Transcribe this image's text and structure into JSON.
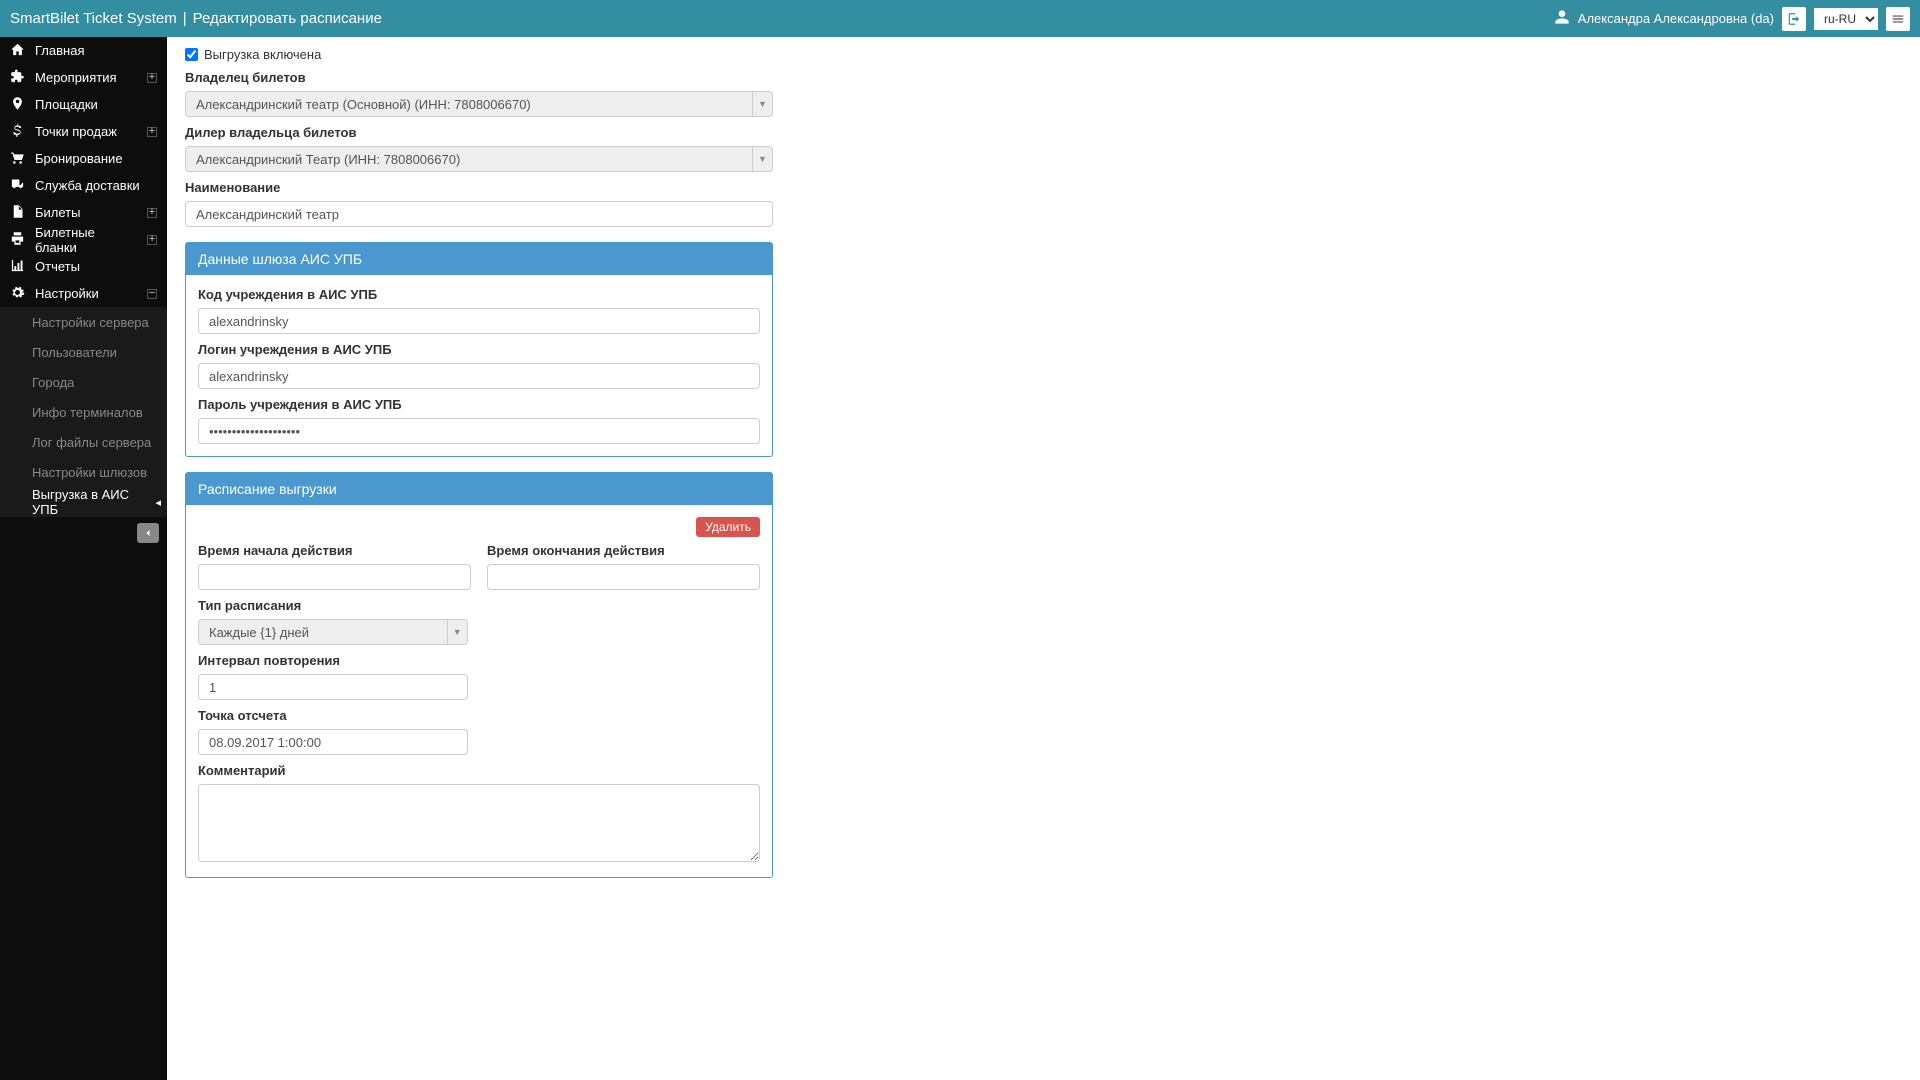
{
  "header": {
    "app_title": "SmartBilet Ticket System",
    "divider": "|",
    "page_title": "Редактировать расписание",
    "user_name": "Александра Александровна (da)",
    "locale": "ru-RU"
  },
  "sidebar": {
    "items": [
      {
        "label": "Главная",
        "icon": "home",
        "expandable": false
      },
      {
        "label": "Мероприятия",
        "icon": "puzzle",
        "expandable": true
      },
      {
        "label": "Площадки",
        "icon": "pin",
        "expandable": false
      },
      {
        "label": "Точки продаж",
        "icon": "dollar",
        "expandable": true
      },
      {
        "label": "Бронирование",
        "icon": "cart",
        "expandable": false
      },
      {
        "label": "Служба доставки",
        "icon": "truck",
        "expandable": false
      },
      {
        "label": "Билеты",
        "icon": "file",
        "expandable": true
      },
      {
        "label": "Билетные бланки",
        "icon": "print",
        "expandable": true
      },
      {
        "label": "Отчеты",
        "icon": "chart",
        "expandable": false
      },
      {
        "label": "Настройки",
        "icon": "gears",
        "expandable": true,
        "expanded": true
      }
    ],
    "subitems": [
      {
        "label": "Настройки сервера"
      },
      {
        "label": "Пользователи"
      },
      {
        "label": "Города"
      },
      {
        "label": "Инфо терминалов"
      },
      {
        "label": "Лог файлы сервера"
      },
      {
        "label": "Настройки шлюзов"
      },
      {
        "label": "Выгрузка в АИС УПБ",
        "active": true
      }
    ]
  },
  "form": {
    "export_enabled_label": "Выгрузка включена",
    "owner_label": "Владелец билетов",
    "owner_value": "Александринский театр (Основной) (ИНН: 7808006670)",
    "dealer_label": "Дилер владельца билетов",
    "dealer_value": "Александринский Театр (ИНН: 7808006670)",
    "name_label": "Наименование",
    "name_value": "Александринский театр"
  },
  "gateway_panel": {
    "title": "Данные шлюза АИС УПБ",
    "code_label": "Код учреждения в АИС УПБ",
    "code_value": "alexandrinsky",
    "login_label": "Логин учреждения в АИС УПБ",
    "login_value": "alexandrinsky",
    "password_label": "Пароль учреждения в АИС УПБ",
    "password_value": "••••••••••••••••••••"
  },
  "schedule_panel": {
    "title": "Расписание выгрузки",
    "delete_label": "Удалить",
    "start_label": "Время начала действия",
    "start_value": "",
    "end_label": "Время окончания действия",
    "end_value": "",
    "type_label": "Тип расписания",
    "type_value": "Каждые {1} дней",
    "interval_label": "Интервал повторения",
    "interval_value": "1",
    "reference_label": "Точка отсчета",
    "reference_value": "08.09.2017 1:00:00",
    "comment_label": "Комментарий",
    "comment_value": ""
  }
}
